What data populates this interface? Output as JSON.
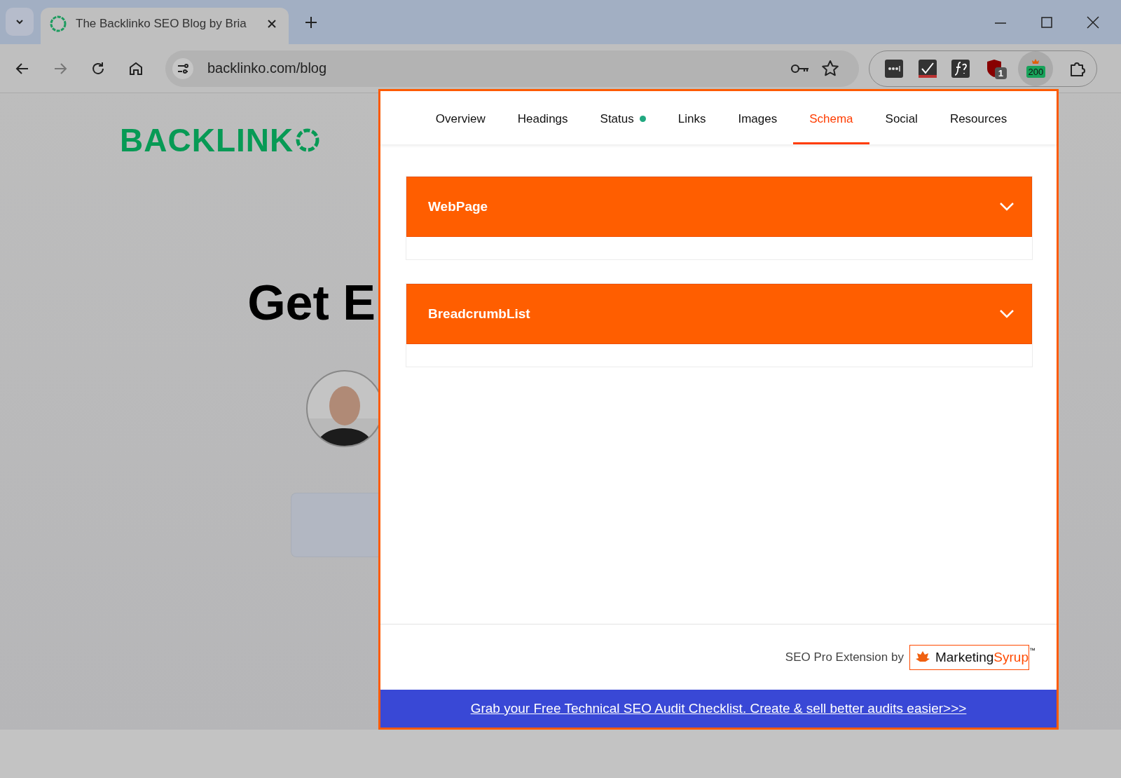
{
  "browser": {
    "tab": {
      "title": "The Backlinko SEO Blog by Bria"
    },
    "address": "backlinko.com/blog",
    "badges": [
      "1",
      "200"
    ]
  },
  "page": {
    "logo": "BACKLINK",
    "heading": "Get E"
  },
  "popup": {
    "tabs": [
      {
        "label": "Overview",
        "selected": false,
        "dot": false
      },
      {
        "label": "Headings",
        "selected": false,
        "dot": false
      },
      {
        "label": "Status",
        "selected": false,
        "dot": true
      },
      {
        "label": "Links",
        "selected": false,
        "dot": false
      },
      {
        "label": "Images",
        "selected": false,
        "dot": false
      },
      {
        "label": "Schema",
        "selected": true,
        "dot": false
      },
      {
        "label": "Social",
        "selected": false,
        "dot": false
      },
      {
        "label": "Resources",
        "selected": false,
        "dot": false
      }
    ],
    "sections": [
      {
        "title": "WebPage",
        "expanded": false
      },
      {
        "title": "BreadcrumbList",
        "expanded": false
      }
    ],
    "footer": {
      "credit": "SEO Pro Extension by",
      "brand": "Marketing",
      "brand_accent": "Syrup",
      "trademark": "™"
    },
    "banner": "Grab your Free Technical SEO Audit Checklist. Create & sell better audits easier>>>"
  }
}
